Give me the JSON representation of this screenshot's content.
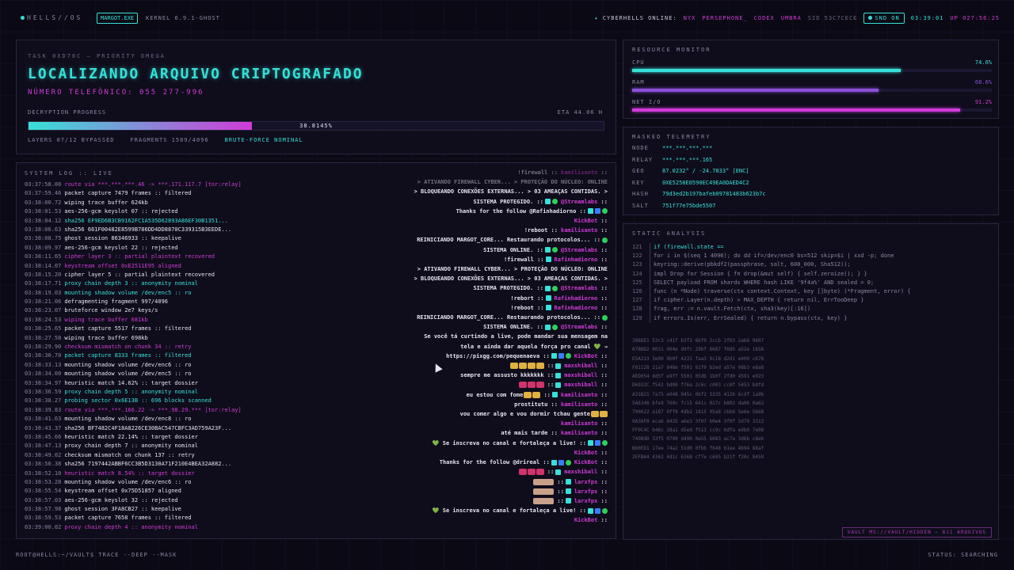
{
  "topbar": {
    "logo": "HELLS//OS",
    "app_badge": "MARGOT.EXE",
    "kernel": "KERNEL 6.9.1-GHOST",
    "online_label": "CYBERHELLS ONLINE:",
    "online_users": [
      "NYX",
      "PERSEPHONE_",
      "CODEX",
      "UMBRA"
    ],
    "sid": "SID 53C7CECE",
    "snd": "SND ON",
    "clock": "03:39:01",
    "uptime": "UP 027:56:25"
  },
  "task": {
    "label": "TASK 0XD70C — PRIORITY OMEGA",
    "title": "LOCALIZANDO ARQUIVO CRIPTOGRAFADO",
    "phone": "NÚMERO TELEFÔNICO: 055 277-996",
    "progress_label": "DECRYPTION PROGRESS",
    "eta": "ETA 44.06 H",
    "progress_pct": 38.8145,
    "progress_text": "38.8145%",
    "layers": "LAYERS 07/12 BYPASSED",
    "fragments": "FRAGMENTS 1589/4096",
    "status": "BRUTE-FORCE NOMINAL"
  },
  "syslog": {
    "title": "SYSTEM LOG :: LIVE",
    "lines": [
      {
        "t": "03:37:58.00",
        "m": "route via ***.***.***.46 -> ***.171.117.7 [tor:relay]",
        "c": "mag"
      },
      {
        "t": "03:37:59.46",
        "m": "packet capture 7479 frames :: filtered",
        "c": "white"
      },
      {
        "t": "03:38:00.72",
        "m": "wiping trace buffer 624kb",
        "c": "white"
      },
      {
        "t": "03:38:01.53",
        "m": "aes-256-gcm keyslot 07 :: rejected",
        "c": "white"
      },
      {
        "t": "03:38:04.12",
        "m": "sha256 EF9ED6B3CB9162FC1A535D62893A86EF30B1351...",
        "c": "cyan"
      },
      {
        "t": "03:38:06.63",
        "m": "sha256 661F00482E8599B786DD4DD8870C339315B3EEDE...",
        "c": "white"
      },
      {
        "t": "03:38:08.75",
        "m": "ghost session 86346933 :: keepalive",
        "c": "white"
      },
      {
        "t": "03:38:09.97",
        "m": "aes-256-gcm keyslot 22 :: rejected",
        "c": "white"
      },
      {
        "t": "03:38:11.65",
        "m": "cipher layer 3 :: partial plaintext recovered",
        "c": "mag"
      },
      {
        "t": "03:38:14.07",
        "m": "keystream offset 0xE2511E95 aligned",
        "c": "mag"
      },
      {
        "t": "03:38:15.20",
        "m": "cipher layer 5 :: partial plaintext recovered",
        "c": "white"
      },
      {
        "t": "03:38:17.71",
        "m": "proxy chain depth 3 :: anonymity nominal",
        "c": "cyan"
      },
      {
        "t": "03:38:19.03",
        "m": "mounting shadow volume /dev/enc5 :: ro",
        "c": "cyan"
      },
      {
        "t": "03:38:21.06",
        "m": "defragmenting fragment 997/4096",
        "c": "white"
      },
      {
        "t": "03:38:23.07",
        "m": "bruteforce window 2e7 keys/s",
        "c": "white"
      },
      {
        "t": "03:38:24.53",
        "m": "wiping trace buffer 681kb",
        "c": "mag"
      },
      {
        "t": "03:38:25.65",
        "m": "packet capture 5517 frames :: filtered",
        "c": "white"
      },
      {
        "t": "03:38:27.58",
        "m": "wiping trace buffer 698kb",
        "c": "white"
      },
      {
        "t": "03:38:29.90",
        "m": "checksum mismatch on chunk 34 :: retry",
        "c": "mag"
      },
      {
        "t": "03:38:30.70",
        "m": "packet capture 8333 frames :: filtered",
        "c": "cyan"
      },
      {
        "t": "03:38:33.13",
        "m": "mounting shadow volume /dev/enc6 :: ro",
        "c": "white"
      },
      {
        "t": "03:38:34.00",
        "m": "mounting shadow volume /dev/enc5 :: ro",
        "c": "white"
      },
      {
        "t": "03:38:34.97",
        "m": "heuristic match 14.62% :: target dossier",
        "c": "white"
      },
      {
        "t": "03:38:36.59",
        "m": "proxy chain depth 5 :: anonymity nominal",
        "c": "cyan"
      },
      {
        "t": "03:38:38.27",
        "m": "probing sector 0x6E13B :: 696 blocks scanned",
        "c": "cyan"
      },
      {
        "t": "03:38:39.83",
        "m": "route via ***.***.166.22 -> ***.98.29.*** [tor:relay]",
        "c": "mag"
      },
      {
        "t": "03:38:41.63",
        "m": "mounting shadow volume /dev/enc8 :: ro",
        "c": "white"
      },
      {
        "t": "03:38:43.37",
        "m": "sha256 BF7482C4F18A8226CE30BAC547CBFC3AD759A23F...",
        "c": "white"
      },
      {
        "t": "03:38:45.66",
        "m": "heuristic match 22.14% :: target dossier",
        "c": "white"
      },
      {
        "t": "03:38:47.13",
        "m": "proxy chain depth 7 :: anonymity nominal",
        "c": "white"
      },
      {
        "t": "03:38:49.02",
        "m": "checksum mismatch on chunk 137 :: retry",
        "c": "white"
      },
      {
        "t": "03:38:50.38",
        "m": "sha256 7197442ABBF6CC3B5D3130A71F210E4BEA32A882...",
        "c": "white"
      },
      {
        "t": "03:38:52.10",
        "m": "heuristic match 8.54% :: target dossier",
        "c": "mag"
      },
      {
        "t": "03:38:53.28",
        "m": "mounting shadow volume /dev/enc6 :: ro",
        "c": "white"
      },
      {
        "t": "03:38:55.54",
        "m": "keystream offset 0x75D51857 aligned",
        "c": "white"
      },
      {
        "t": "03:38:57.03",
        "m": "aes-256-gcm keyslot 32 :: rejected",
        "c": "white"
      },
      {
        "t": "03:38:57.98",
        "m": "ghost session 3FA8CB27 :: keepalive",
        "c": "white"
      },
      {
        "t": "03:38:59.53",
        "m": "packet capture 7658 frames :: filtered",
        "c": "white"
      },
      {
        "t": "03:39:00.02",
        "m": "proxy chain depth 4 :: anonymity nominal",
        "c": "mag"
      }
    ]
  },
  "chat": [
    {
      "msg": "!firewall",
      "user": "kamilisanto",
      "icons": [],
      "dim": true
    },
    {
      "msg": "> ATIVANDO FIREWALL CYBER... > PROTEÇÃO DO NÚCLEO: ONLINE",
      "user": "",
      "icons": [],
      "dim": true
    },
    {
      "msg": "> BLOQUEANDO CONEXÕES EXTERNAS... > 03 AMEAÇAS CONTIDAS. >",
      "user": "",
      "icons": []
    },
    {
      "msg": "SISTEMA PROTEGIDO.",
      "user": "@Streamlabs",
      "icons": [
        "k",
        "g"
      ]
    },
    {
      "msg": "Thanks for the follow @Rafinhadiorno",
      "user": "",
      "icons": [
        "k",
        "b",
        "g"
      ]
    },
    {
      "msg": "",
      "user": "KickBot",
      "icons": []
    },
    {
      "msg": "!reboot",
      "user": "kamilisanto",
      "icons": []
    },
    {
      "msg": "REINICIANDO MARGOT_CORE... Restaurando protocolos...",
      "user": "",
      "icons": [
        "g"
      ]
    },
    {
      "msg": "SISTEMA ONLINE.",
      "user": "@Streamlabs",
      "icons": [
        "k",
        "g"
      ]
    },
    {
      "msg": "!firewall",
      "user": "Rafinhadiorno",
      "icons": [
        "k"
      ]
    },
    {
      "msg": "> ATIVANDO FIREWALL CYBER... > PROTEÇÃO DO NÚCLEO: ONLINE",
      "user": "",
      "icons": []
    },
    {
      "msg": "> BLOQUEANDO CONEXÕES EXTERNAS... > 03 AMEAÇAS CONTIDAS. >",
      "user": "",
      "icons": []
    },
    {
      "msg": "SISTEMA PROTEGIDO.",
      "user": "@Streamlabs",
      "icons": [
        "k",
        "g"
      ]
    },
    {
      "msg": "!rebort",
      "user": "Rafinhadiorno",
      "icons": [
        "k"
      ]
    },
    {
      "msg": "!reboot",
      "user": "Rafinhadiorno",
      "icons": [
        "k"
      ]
    },
    {
      "msg": "REINICIANDO MARGOT_CORE... Restaurando protocolos...",
      "user": "",
      "icons": [
        "g"
      ]
    },
    {
      "msg": "SISTEMA ONLINE.",
      "user": "@Streamlabs",
      "icons": [
        "k",
        "g"
      ]
    },
    {
      "msg": "Se você tá curtindo a live, pode mandar sua mensagem na",
      "user": "",
      "icons": []
    },
    {
      "msg": "tela e ainda dar aquela força pro canal 💚 →",
      "user": "",
      "icons": []
    },
    {
      "msg": "https://pixgg.com/pequenaeva",
      "user": "KickBot",
      "icons": [
        "k",
        "b",
        "g"
      ]
    },
    {
      "msg": "",
      "user": "maxshiball",
      "icons": [
        "k"
      ],
      "emotes": 4
    },
    {
      "msg": "sempre me assusto kkkkkkk",
      "user": "maxshiball",
      "icons": [
        "k"
      ]
    },
    {
      "msg": "",
      "user": "maxshiball",
      "icons": [
        "k"
      ],
      "emotes": 3
    },
    {
      "msg": "eu estou com fome",
      "user": "kamilisanto",
      "icons": [
        "k"
      ],
      "emotes": 2
    },
    {
      "msg": "prostitutu",
      "user": "kamilisanto",
      "icons": []
    },
    {
      "msg": "vou comer algo e vou dormir tchau gente",
      "user": "",
      "icons": [],
      "emotes": 2
    },
    {
      "msg": "",
      "user": "kamilisanto",
      "icons": []
    },
    {
      "msg": "até mais tarde",
      "user": "kamilisanto",
      "icons": []
    },
    {
      "msg": "💚 Se inscreva no canal e fortaleça a live!",
      "user": "",
      "icons": [
        "k",
        "b",
        "g"
      ]
    },
    {
      "msg": "",
      "user": "KickBot",
      "icons": []
    },
    {
      "msg": "Thanks for the follow @drireal",
      "user": "KickBot",
      "icons": [
        "k",
        "b",
        "g"
      ]
    },
    {
      "msg": "",
      "user": "maxshiball",
      "icons": [
        "k"
      ],
      "emotes": 3
    },
    {
      "msg": "",
      "user": "larxfps",
      "icons": [
        "k"
      ],
      "emotes": 1
    },
    {
      "msg": "",
      "user": "larxfps",
      "icons": [
        "k"
      ],
      "emotes": 1
    },
    {
      "msg": "",
      "user": "larxfps",
      "icons": [
        "k"
      ],
      "emotes": 1
    },
    {
      "msg": "💚 Se inscreva no canal e fortaleça a live!",
      "user": "",
      "icons": [
        "k",
        "b",
        "g"
      ]
    },
    {
      "msg": "",
      "user": "KickBot",
      "icons": []
    }
  ],
  "resource_monitor": {
    "title": "RESOURCE MONITOR",
    "rows": [
      {
        "label": "CPU",
        "value": "74.6%",
        "pct": 74.6,
        "color": "#37e0d8"
      },
      {
        "label": "RAM",
        "value": "68.6%",
        "pct": 68.6,
        "color": "#8b4fd8"
      },
      {
        "label": "NET I/O",
        "value": "91.2%",
        "pct": 91.2,
        "color": "#d13bd8"
      }
    ]
  },
  "telemetry": {
    "title": "MASKED TELEMETRY",
    "rows": [
      {
        "k": "NODE",
        "v": "***.***.***.***"
      },
      {
        "k": "RELAY",
        "v": "***.***.***.165"
      },
      {
        "k": "GEO",
        "v": "87.0232° / -24.7833° [ENC]"
      },
      {
        "k": "KEY",
        "v": "0XE5258E0590EC49EA0DAED4C2"
      },
      {
        "k": "HASH",
        "v": "79d3ed2b197bafeb09781483b623b7c"
      },
      {
        "k": "SALT",
        "v": "751f77e75bde5507"
      }
    ]
  },
  "static_analysis": {
    "title": "STATIC ANALYSIS",
    "code": [
      {
        "n": "121",
        "s": "if (firewall.state ==",
        "hl": 1
      },
      {
        "n": "122",
        "s": "for i in $(seq 1 4096); do dd if=/dev/enc0 bs=512 skip=$i | xxd -p; done",
        "hl": 0
      },
      {
        "n": "123",
        "s": "keyring::derive(pbkdf2(passphrase, salt, 600_000, Sha512));",
        "hl": 0
      },
      {
        "n": "124",
        "s": "impl Drop for Session { fn drop(&mut self) { self.zeroize(); } }",
        "hl": 0
      },
      {
        "n": "125",
        "s": "SELECT payload FROM shards WHERE hash LIKE '9f4a%' AND sealed = 0;",
        "hl": 0
      },
      {
        "n": "126",
        "s": "func (n *Node) traverse(ctx context.Context, key []byte) (*Fragment, error) {",
        "hl": 0
      },
      {
        "n": "127",
        "s": "if cipher.Layer(n.depth) > MAX_DEPTH { return nil, ErrTooDeep }",
        "hl": 0
      },
      {
        "n": "128",
        "s": "frag, err := n.vault.Fetch(ctx, sha3(key)[:16])",
        "hl": 0
      },
      {
        "n": "129",
        "s": "if errors.Is(err, ErrSealed) { return n.bypass(ctx, key) }",
        "hl": 0
      }
    ],
    "hex": [
      "386DE1 53c3 c41f b3f3 6bf0 2ccb 2f03 2ab6 9607",
      "678BD2 0031 004e d9fc 29bf 6687 f685 a52e 1b58",
      "E5A223 3e00 0b0f 4231 faa3 9c18 d2d1 e000 c678",
      "F81128 21a7 848e f501 81f0 b2ed a57e 08b3 e8a8",
      "AED054 dd5f e9ff 5501 05db 1b0f 2fd0 4591 e923",
      "D6932C f542 bd00 f76a 2c6c c003 cc0f 5453 b8fd",
      "A31B21 7a75 e048 945c 0bf2 3335 412b 6cdf 1a9b",
      "5A6346 bfe9 760c fc15 641c 027c b802 da06 0a63",
      "790622 a187 0ff8 4db2 1815 95a8 cbb6 5e6e 5b68",
      "9A36F8 eca6 8435 a6e3 3f07 b0e4 3f0f 5d70 3313",
      "FF0C4C b46c 28a1 d5ed f513 cc9c 6dfa e0b0 7e08",
      "740B9D 33f5 0790 d490 0e55 6083 ac7a 3d6b c8eb",
      "B60ED1 17ee 74a2 51d0 0fbb f648 61ee 4b94 88af",
      "2EFBA4 4362 4d1c 6368 cf7e c605 b21f f20c 8459"
    ],
    "vault": "VAULT MS://VAULT/HIDDEN — 811 ARQUIVOS"
  },
  "footer": {
    "prompt": "ROOT@HELLS:~/VAULT$ TRACE --DEEP --MASK",
    "status": "STATUS: SEARCHING"
  }
}
